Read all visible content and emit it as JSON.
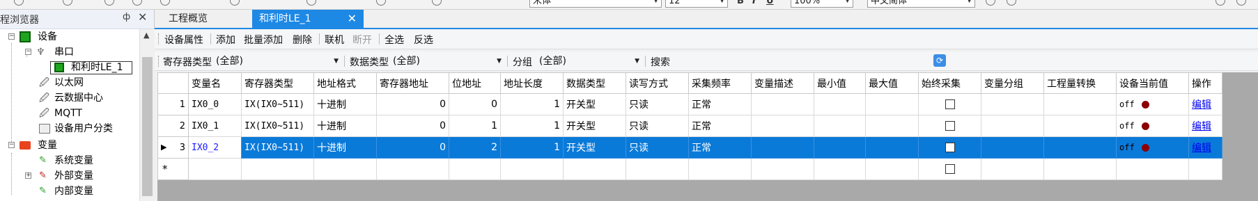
{
  "toolbar": {
    "font_name": "宋体",
    "font_size": "12",
    "bold": "B",
    "italic": "I",
    "underline": "U",
    "zoom": "100%",
    "language": "中文简体"
  },
  "panel": {
    "title": "程浏览器",
    "pin": "ㅁ",
    "close": "✕",
    "tree": [
      {
        "label": "设备",
        "icon": "device-icon"
      },
      {
        "label": "串口",
        "icon": "serial-icon"
      },
      {
        "label": "和利时LE_1",
        "icon": "plc-icon"
      },
      {
        "label": "以太网",
        "icon": "ethernet-icon"
      },
      {
        "label": "云数据中心",
        "icon": "cloud-icon"
      },
      {
        "label": "MQTT",
        "icon": "mqtt-icon"
      },
      {
        "label": "设备用户分类",
        "icon": "category-icon"
      },
      {
        "label": "变量",
        "icon": "variable-icon"
      },
      {
        "label": "系统变量",
        "icon": "system-var-icon"
      },
      {
        "label": "外部变量",
        "icon": "external-var-icon"
      },
      {
        "label": "内部变量",
        "icon": "internal-var-icon"
      }
    ]
  },
  "tabs": [
    {
      "label": "工程概览"
    },
    {
      "label": "和利时LE_1",
      "close": "✕"
    }
  ],
  "actions": {
    "device_props": "设备属性",
    "add": "添加",
    "batch_add": "批量添加",
    "delete": "删除",
    "online": "联机",
    "disconnect": "断开",
    "select_all": "全选",
    "invert": "反选"
  },
  "filters": {
    "register_type_label": "寄存器类型",
    "register_type_value": "(全部)",
    "data_type_label": "数据类型",
    "data_type_value": "(全部)",
    "group_label": "分组",
    "group_value": "(全部)",
    "search_label": "搜索"
  },
  "grid": {
    "columns": [
      "变量名",
      "寄存器类型",
      "地址格式",
      "寄存器地址",
      "位地址",
      "地址长度",
      "数据类型",
      "读写方式",
      "采集频率",
      "变量描述",
      "最小值",
      "最大值",
      "始终采集",
      "变量分组",
      "工程量转换",
      "设备当前值",
      "操作"
    ],
    "rows": [
      {
        "index": "1",
        "name": "IX0_0",
        "reg_type": "IX(IX0~511)",
        "addr_fmt": "十进制",
        "reg_addr": "0",
        "bit_addr": "0",
        "addr_len": "1",
        "data_type": "开关型",
        "rw": "只读",
        "freq": "正常",
        "desc": "",
        "min": "",
        "max": "",
        "always": false,
        "group": "",
        "conv": "",
        "value": "off",
        "action": "编辑"
      },
      {
        "index": "2",
        "name": "IX0_1",
        "reg_type": "IX(IX0~511)",
        "addr_fmt": "十进制",
        "reg_addr": "0",
        "bit_addr": "1",
        "addr_len": "1",
        "data_type": "开关型",
        "rw": "只读",
        "freq": "正常",
        "desc": "",
        "min": "",
        "max": "",
        "always": false,
        "group": "",
        "conv": "",
        "value": "off",
        "action": "编辑"
      },
      {
        "index": "3",
        "name": "IX0_2",
        "reg_type": "IX(IX0~511)",
        "addr_fmt": "十进制",
        "reg_addr": "0",
        "bit_addr": "2",
        "addr_len": "1",
        "data_type": "开关型",
        "rw": "只读",
        "freq": "正常",
        "desc": "",
        "min": "",
        "max": "",
        "always": false,
        "group": "",
        "conv": "",
        "value": "off",
        "action": "编辑",
        "selected": true,
        "marker": "▶"
      }
    ],
    "new_row_marker": "*"
  },
  "colors": {
    "accent": "#1e88e5",
    "selection": "#0a7ad9",
    "status_off": "#8b0000"
  }
}
